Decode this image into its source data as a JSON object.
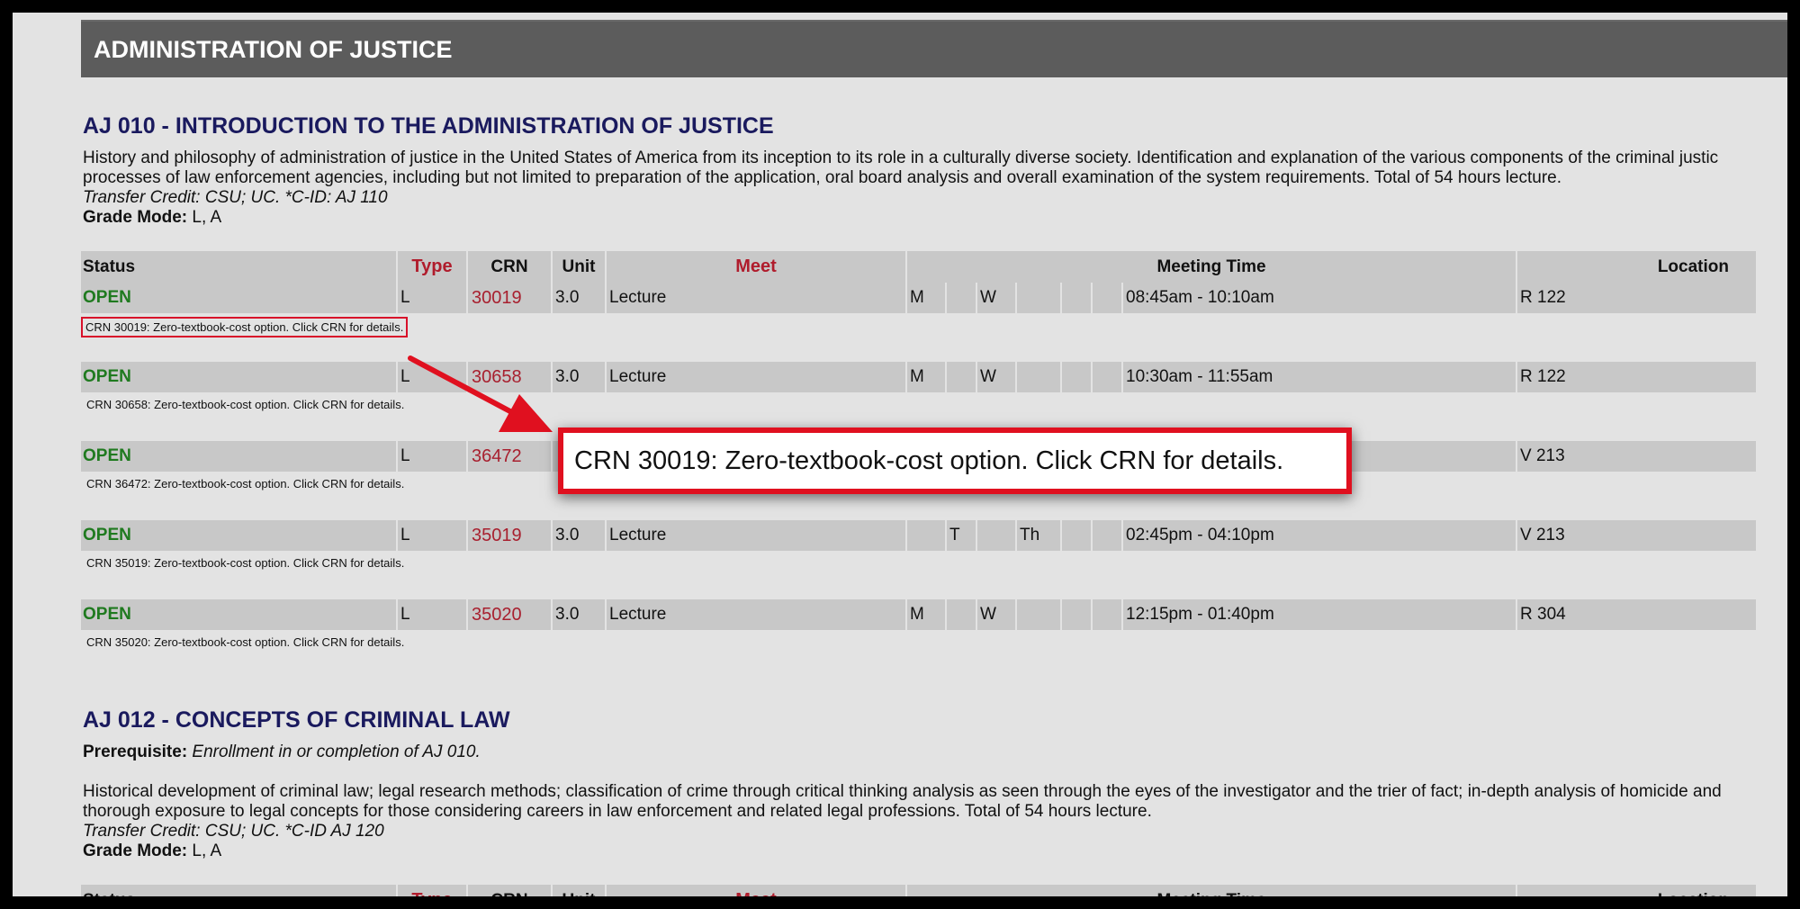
{
  "department": {
    "title": "ADMINISTRATION OF JUSTICE"
  },
  "columns": {
    "status": "Status",
    "type": "Type",
    "crn": "CRN",
    "unit": "Unit",
    "meet": "Meet",
    "meeting_time": "Meeting Time",
    "location": "Location"
  },
  "courses": [
    {
      "title": "AJ 010 - INTRODUCTION TO THE ADMINISTRATION OF JUSTICE",
      "description_line1": "History and philosophy of administration of justice in the United States of America from its inception to its role in a culturally diverse society. Identification and explanation of the various components of the criminal justic",
      "description_line2": "processes of law enforcement agencies, including but not limited to preparation of the application, oral board analysis and overall examination of the system requirements. Total of 54 hours lecture.",
      "transfer_credit": "Transfer Credit: CSU; UC. *C-ID: AJ 110",
      "grade_mode_label": "Grade Mode:",
      "grade_mode_value": " L, A",
      "sections": [
        {
          "status": "OPEN",
          "type": "L",
          "crn": "30019",
          "unit": "3.0",
          "meet": "Lecture",
          "days": [
            "M",
            "",
            "W",
            "",
            "",
            ""
          ],
          "time": "08:45am - 10:10am",
          "location": "R 122",
          "note": "CRN 30019: Zero-textbook-cost option. Click CRN for details."
        },
        {
          "status": "OPEN",
          "type": "L",
          "crn": "30658",
          "unit": "3.0",
          "meet": "Lecture",
          "days": [
            "M",
            "",
            "W",
            "",
            "",
            ""
          ],
          "time": "10:30am - 11:55am",
          "location": "R 122",
          "note": "CRN 30658: Zero-textbook-cost option. Click CRN for details."
        },
        {
          "status": "OPEN",
          "type": "L",
          "crn": "36472",
          "unit": "",
          "meet": "",
          "days": [
            "",
            "",
            "",
            "",
            "",
            ""
          ],
          "time": "",
          "location": "V 213",
          "note": "CRN 36472: Zero-textbook-cost option. Click CRN for details."
        },
        {
          "status": "OPEN",
          "type": "L",
          "crn": "35019",
          "unit": "3.0",
          "meet": "Lecture",
          "days": [
            "",
            "T",
            "",
            "Th",
            "",
            ""
          ],
          "time": "02:45pm - 04:10pm",
          "location": "V 213",
          "note": "CRN 35019: Zero-textbook-cost option. Click CRN for details."
        },
        {
          "status": "OPEN",
          "type": "L",
          "crn": "35020",
          "unit": "3.0",
          "meet": "Lecture",
          "days": [
            "M",
            "",
            "W",
            "",
            "",
            ""
          ],
          "time": "12:15pm - 01:40pm",
          "location": "R 304",
          "note": "CRN 35020: Zero-textbook-cost option. Click CRN for details."
        }
      ]
    },
    {
      "title": "AJ 012 - CONCEPTS OF CRIMINAL LAW",
      "prerequisite_label": "Prerequisite:",
      "prerequisite_value": " Enrollment in or completion of AJ 010.",
      "description_line1": "Historical development of criminal law; legal research methods; classification of crime through critical thinking analysis as seen through the eyes of the investigator and the trier of fact; in-depth analysis of homicide and",
      "description_line2": "thorough exposure to legal concepts for those considering careers in law enforcement and related legal professions. Total of 54 hours lecture.",
      "transfer_credit": "Transfer Credit: CSU; UC. *C-ID AJ 120",
      "grade_mode_label": "Grade Mode:",
      "grade_mode_value": " L, A"
    }
  ],
  "callout": {
    "text": "CRN 30019: Zero-textbook-cost option. Click CRN for details."
  },
  "colors": {
    "header_bar": "#5c5c5c",
    "course_title": "#1a1a5e",
    "status_open": "#1f7a1f",
    "crn_link": "#a8202f",
    "highlight_red": "#e0101f"
  }
}
